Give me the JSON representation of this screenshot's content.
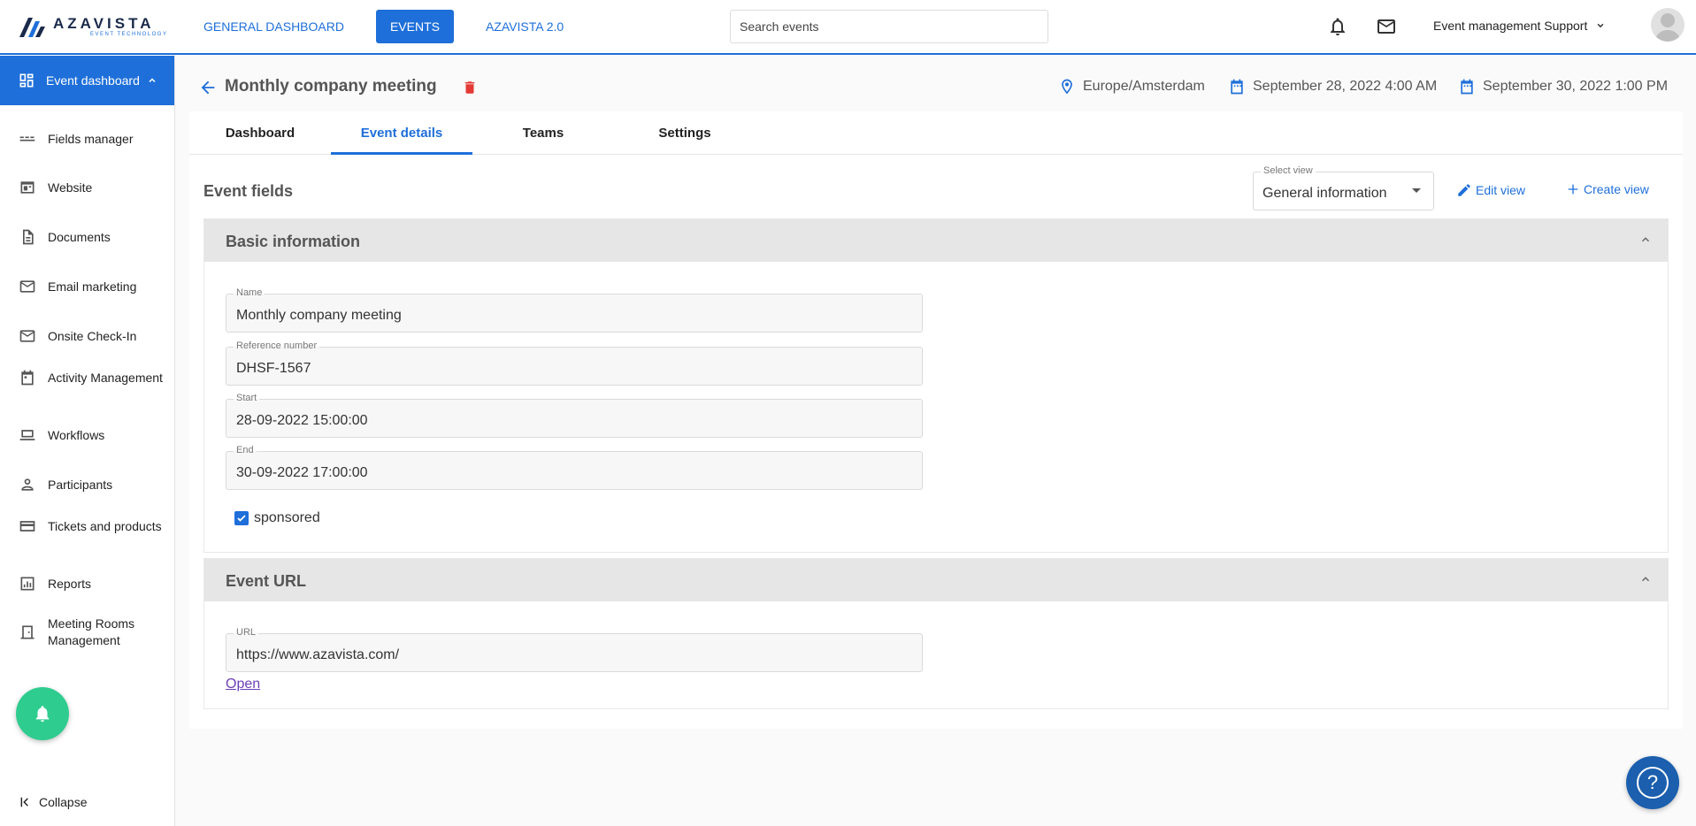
{
  "brand": {
    "name": "AZAVISTA",
    "tagline": "EVENT TECHNOLOGY"
  },
  "topnav": {
    "items": [
      {
        "label": "GENERAL DASHBOARD"
      },
      {
        "label": "EVENTS",
        "active": true
      },
      {
        "label": "AZAVISTA 2.0"
      }
    ]
  },
  "search": {
    "placeholder": "Search events"
  },
  "account": {
    "name": "Event management Support"
  },
  "sidebar": {
    "active_label": "Event dashboard",
    "items": [
      {
        "label": "Fields manager",
        "icon": "fields-icon"
      },
      {
        "label": "Website",
        "icon": "website-icon"
      },
      {
        "label": "Documents",
        "icon": "document-icon"
      },
      {
        "label": "Email marketing",
        "icon": "mail-icon"
      },
      {
        "label": "Onsite Check-In",
        "icon": "mail-icon"
      },
      {
        "label": "Activity Management",
        "icon": "calendar-icon"
      },
      {
        "label": "Workflows",
        "icon": "laptop-icon"
      },
      {
        "label": "Participants",
        "icon": "person-icon"
      },
      {
        "label": "Tickets and products",
        "icon": "card-icon"
      },
      {
        "label": "Reports",
        "icon": "chart-icon"
      },
      {
        "label": "Meeting Rooms Management",
        "icon": "door-icon"
      }
    ],
    "collapse_label": "Collapse"
  },
  "header": {
    "title": "Monthly company meeting",
    "timezone": "Europe/Amsterdam",
    "start": "September 28, 2022 4:00 AM",
    "end": "September 30, 2022 1:00 PM"
  },
  "tabs": [
    {
      "label": "Dashboard"
    },
    {
      "label": "Event details",
      "active": true
    },
    {
      "label": "Teams"
    },
    {
      "label": "Settings"
    }
  ],
  "event_fields": {
    "title": "Event fields",
    "select_view_label": "Select view",
    "select_view_value": "General information",
    "edit_view_label": "Edit view",
    "create_view_label": "Create view"
  },
  "basic_info": {
    "title": "Basic information",
    "name_label": "Name",
    "name_value": "Monthly company meeting",
    "ref_label": "Reference number",
    "ref_value": "DHSF-1567",
    "start_label": "Start",
    "start_value": "28-09-2022 15:00:00",
    "end_label": "End",
    "end_value": "30-09-2022 17:00:00",
    "sponsored_label": "sponsored",
    "sponsored_checked": true
  },
  "event_url": {
    "title": "Event URL",
    "url_label": "URL",
    "url_value": "https://www.azavista.com/",
    "open_label": "Open"
  },
  "colors": {
    "accent": "#1e6fd9",
    "danger": "#e53935",
    "success": "#2ecc8f",
    "help": "#1b5fae"
  }
}
